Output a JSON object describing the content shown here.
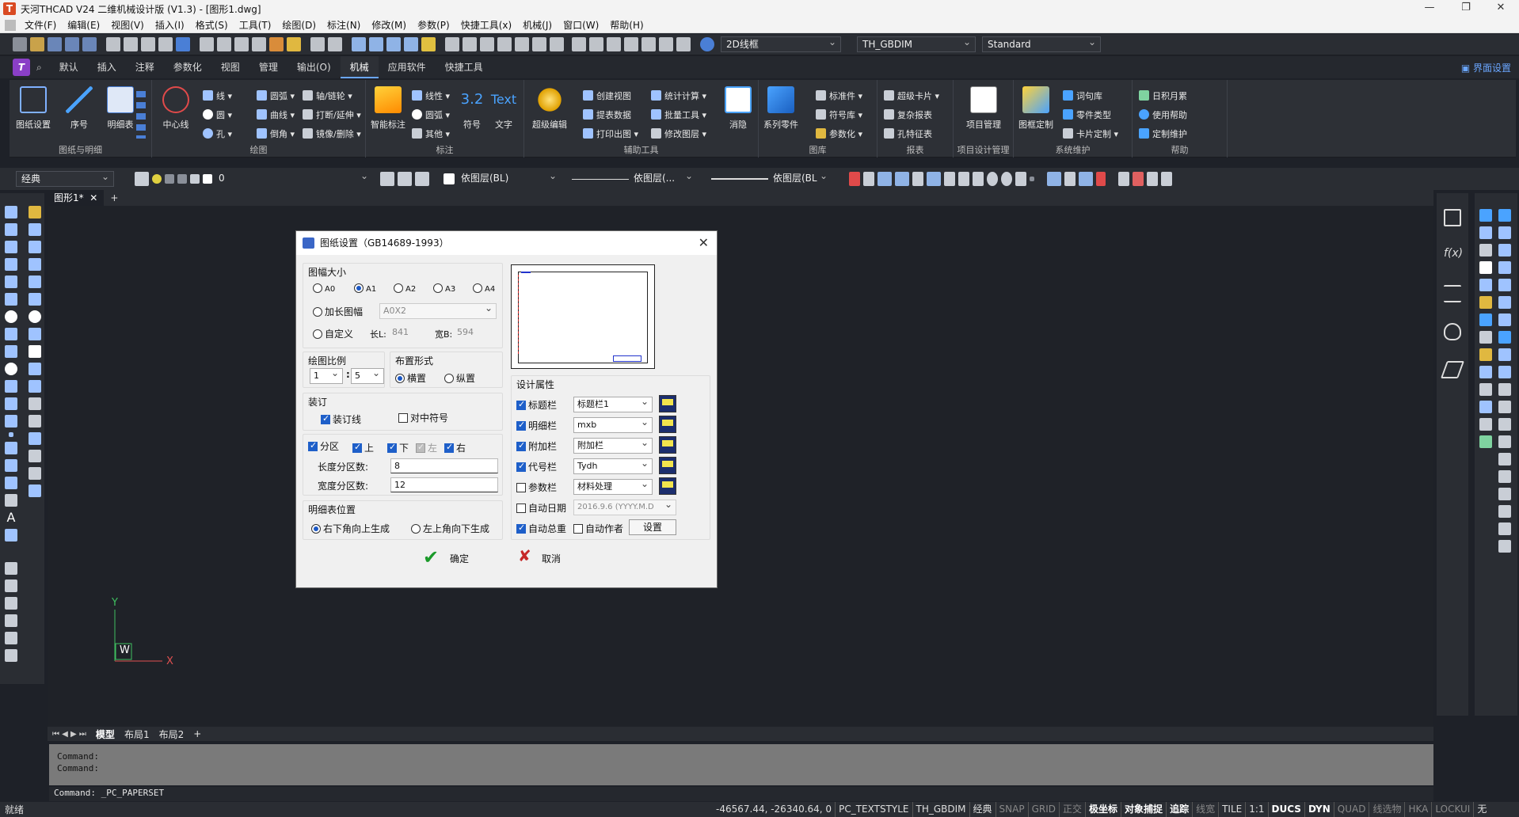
{
  "window": {
    "title": "天河THCAD V24 二维机械设计版 (V1.3) - [图形1.dwg]",
    "minimize": "—",
    "restore": "❐",
    "close": "✕"
  },
  "menu": [
    "文件(F)",
    "编辑(E)",
    "视图(V)",
    "插入(I)",
    "格式(S)",
    "工具(T)",
    "绘图(D)",
    "标注(N)",
    "修改(M)",
    "参数(P)",
    "快捷工具(x)",
    "机械(J)",
    "窗口(W)",
    "帮助(H)"
  ],
  "quickbar": {
    "visual_style": "2D线框",
    "dim_style": "TH_GBDIM",
    "text_style": "Standard"
  },
  "ribbon_tabs": [
    "默认",
    "插入",
    "注释",
    "参数化",
    "视图",
    "管理",
    "输出(O)",
    "机械",
    "应用软件",
    "快捷工具"
  ],
  "ribbon_active_tab": "机械",
  "ui_settings": "界面设置",
  "ribbon": {
    "groups": [
      {
        "label": "图纸与明细",
        "big": [
          "图纸设置",
          "序号",
          "明细表"
        ]
      },
      {
        "label": "绘图",
        "big": [
          "中心线"
        ],
        "small": [
          "线",
          "圆弧",
          "轴/链轮",
          "圆",
          "曲线",
          "打断/延伸",
          "孔",
          "倒角",
          "镜像/删除"
        ]
      },
      {
        "label": "标注",
        "big": [
          "智能标注",
          "符号",
          "文字"
        ],
        "small": [
          "线性",
          "圆弧",
          "其他"
        ],
        "text_icon": "Text"
      },
      {
        "label": "辅助工具",
        "big": [
          "超级编辑",
          "消隐"
        ],
        "small": [
          "创建视图",
          "统计计算",
          "提表数据",
          "批量工具",
          "打印出图",
          "修改图层"
        ]
      },
      {
        "label": "图库",
        "big": [
          "系列零件"
        ],
        "small": [
          "标准件",
          "符号库",
          "参数化"
        ]
      },
      {
        "label": "报表",
        "small": [
          "超级卡片",
          "复杂报表",
          "孔特征表"
        ]
      },
      {
        "label": "项目设计管理",
        "big": [
          "项目管理"
        ]
      },
      {
        "label": "系统维护",
        "big": [
          "图框定制"
        ],
        "small": [
          "词句库",
          "零件类型",
          "卡片定制"
        ]
      },
      {
        "label": "帮助",
        "small": [
          "日积月累",
          "使用帮助",
          "定制维护"
        ]
      }
    ]
  },
  "propbar": {
    "workspace": "经典",
    "layer": "0",
    "color": "依图层(BL)",
    "linetype": "依图层(...",
    "lineweight": "依图层(BL"
  },
  "doc_tab": {
    "name": "图形1*",
    "close": "✕",
    "add": "+"
  },
  "layout_tabs": [
    "模型",
    "布局1",
    "布局2",
    "+"
  ],
  "ucs": {
    "x": "X",
    "y": "Y",
    "w": "W"
  },
  "command": {
    "history": [
      "Command:",
      "Command:"
    ],
    "current": "Command: _PC_PAPERSET"
  },
  "status": {
    "ready": "就绪",
    "coords": "-46567.44, -26340.64, 0",
    "items": [
      "PC_TEXTSTYLE",
      "TH_GBDIM",
      "经典",
      "SNAP",
      "GRID",
      "正交",
      "极坐标",
      "对象捕捉",
      "追踪",
      "线宽",
      "TILE",
      "1:1",
      "DUCS",
      "DYN",
      "QUAD",
      "线选物",
      "HKA",
      "LOCKUI",
      "无"
    ],
    "on": [
      "极坐标",
      "对象捕捉",
      "追踪",
      "DUCS",
      "DYN"
    ]
  },
  "dialog": {
    "title": "图纸设置（GB14689-1993）",
    "paper_size": {
      "legend": "图幅大小",
      "options": [
        "A0",
        "A1",
        "A2",
        "A3",
        "A4"
      ],
      "selected": "A1",
      "extended": "加长图幅",
      "extended_value": "A0X2",
      "custom": "自定义",
      "length_label": "长L:",
      "length": "841",
      "width_label": "宽B:",
      "width": "594"
    },
    "scale": {
      "legend": "绘图比例",
      "left": "1",
      "sep": ":",
      "right": "5"
    },
    "layout": {
      "legend": "布置形式",
      "options": [
        "横置",
        "纵置"
      ],
      "selected": "横置"
    },
    "binding": {
      "legend": "装订",
      "binding_line": "装订线",
      "center_mark": "对中符号"
    },
    "zones": {
      "label": "分区",
      "top": "上",
      "bottom": "下",
      "left": "左",
      "right": "右",
      "length_label": "长度分区数:",
      "length": "8",
      "width_label": "宽度分区数:",
      "width": "12"
    },
    "bom": {
      "legend": "明细表位置",
      "options": [
        "右下角向上生成",
        "左上角向下生成"
      ],
      "selected": "右下角向上生成"
    },
    "design": {
      "legend": "设计属性",
      "rows": [
        {
          "label": "标题栏",
          "value": "标题栏1",
          "checked": true
        },
        {
          "label": "明细栏",
          "value": "mxb",
          "checked": true
        },
        {
          "label": "附加栏",
          "value": "附加栏",
          "checked": true
        },
        {
          "label": "代号栏",
          "value": "Tydh",
          "checked": true
        },
        {
          "label": "参数栏",
          "value": "材料处理",
          "checked": false
        }
      ],
      "auto_date": "自动日期",
      "date_value": "2016.9.6 (YYYY.M.D",
      "auto_total": "自动总重",
      "auto_author": "自动作者",
      "settings_btn": "设置"
    },
    "ok": "确定",
    "cancel": "取消"
  },
  "colors": {
    "accent": "#1e5fc9",
    "canvas": "#1f2228",
    "panel": "#2d3036"
  }
}
